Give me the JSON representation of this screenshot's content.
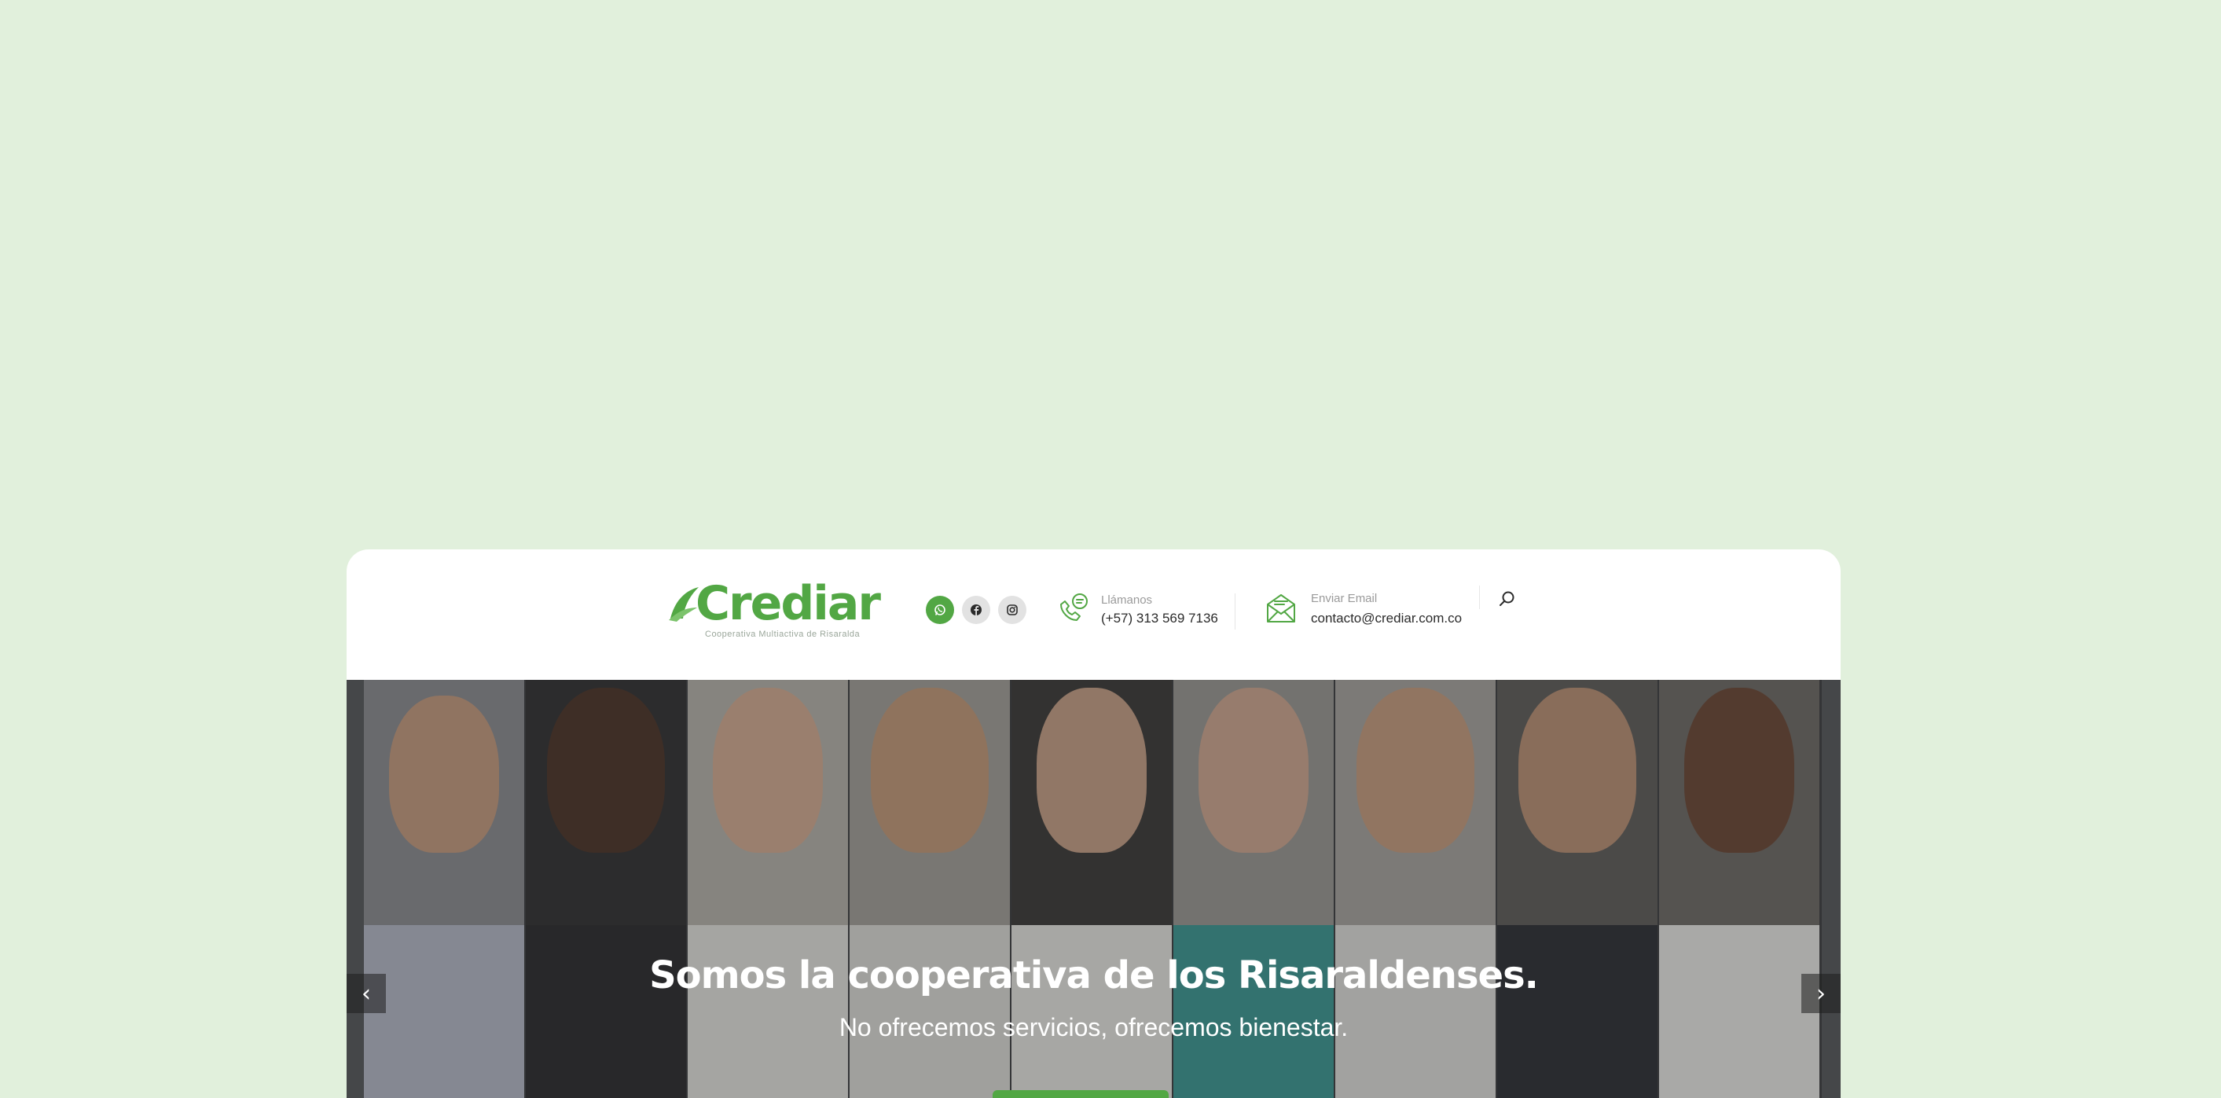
{
  "brand": {
    "name": "Crediar",
    "tagline": "Cooperativa Multiactiva de Risaralda",
    "color": "#52a744"
  },
  "social": [
    {
      "name": "whatsapp",
      "icon": "whatsapp-icon"
    },
    {
      "name": "facebook",
      "icon": "facebook-icon"
    },
    {
      "name": "instagram",
      "icon": "instagram-icon"
    }
  ],
  "contact": {
    "phone": {
      "label": "Llámanos",
      "value": "(+57) 313 569 7136",
      "icon": "phone-chat-icon"
    },
    "email": {
      "label": "Enviar Email",
      "value": "contacto@crediar.com.co",
      "icon": "envelope-icon"
    }
  },
  "search": {
    "icon": "search-icon"
  },
  "hero": {
    "title": "Somos la cooperativa de los Risaraldenses.",
    "subtitle": "No ofrecemos servicios, ofrecemos bienestar.",
    "prev_icon": "chevron-left-icon",
    "next_icon": "chevron-right-icon",
    "prev_glyph": "‹",
    "next_glyph": "›"
  },
  "colors": {
    "page_background": "#e1f0dc",
    "accent": "#52a744",
    "social_inactive": "#e2e2e2"
  }
}
